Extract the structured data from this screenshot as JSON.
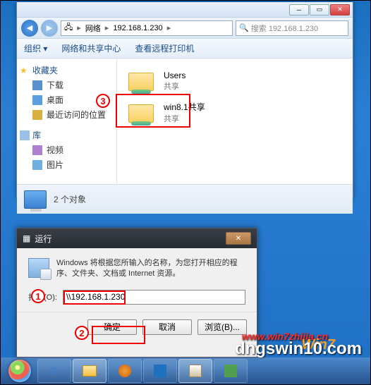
{
  "explorer": {
    "nav_back_glyph": "◀",
    "nav_fwd_glyph": "▶",
    "address_parts": [
      "网络",
      "192.168.1.230"
    ],
    "search_placeholder": "搜索 192.168.1.230",
    "toolbar": {
      "organize": "组织 ▾",
      "netshare": "网络和共享中心",
      "remoteprn": "查看远程打印机"
    },
    "sidebar": {
      "fav_label": "收藏夹",
      "downloads": "下载",
      "desktop": "桌面",
      "recent": "最近访问的位置",
      "lib_label": "库",
      "video": "视频",
      "pic": "图片"
    },
    "folders": [
      {
        "name": "Users",
        "sub": "共享"
      },
      {
        "name": "win8.1共享",
        "sub": "共享"
      }
    ],
    "status": "2 个对象"
  },
  "rundlg": {
    "title": "运行",
    "desc": "Windows 将根据您所输入的名称，为您打开相应的程序、文件夹、文档或 Internet 资源。",
    "open_label": "打开(O):",
    "value": "\\\\192.168.1.230",
    "ok": "确定",
    "cancel": "取消",
    "browse": "浏览(B)..."
  },
  "annotations": {
    "n1": "1",
    "n2": "2",
    "n3": "3"
  },
  "watermarks": {
    "w1": "www.win7zhijia.cn",
    "w2": "dngswin10.com",
    "w3": "Win7"
  },
  "winbtns": {
    "min": "─",
    "max": "▭",
    "close": "✕"
  }
}
